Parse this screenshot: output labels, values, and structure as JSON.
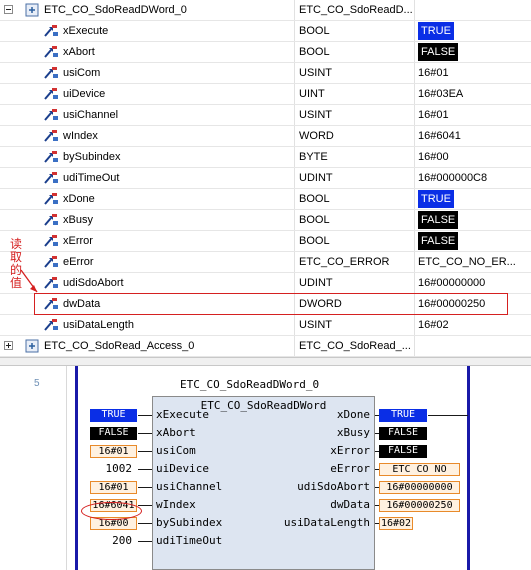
{
  "watch": {
    "parent": {
      "name": "ETC_CO_SdoReadDWord_0",
      "type": "ETC_CO_SdoReadD..."
    },
    "rows": [
      {
        "name": "xExecute",
        "type": "BOOL",
        "value": "TRUE",
        "kind": "true"
      },
      {
        "name": "xAbort",
        "type": "BOOL",
        "value": "FALSE",
        "kind": "false"
      },
      {
        "name": "usiCom",
        "type": "USINT",
        "value": "16#01",
        "kind": "text"
      },
      {
        "name": "uiDevice",
        "type": "UINT",
        "value": "16#03EA",
        "kind": "text"
      },
      {
        "name": "usiChannel",
        "type": "USINT",
        "value": "16#01",
        "kind": "text"
      },
      {
        "name": "wIndex",
        "type": "WORD",
        "value": "16#6041",
        "kind": "text"
      },
      {
        "name": "bySubindex",
        "type": "BYTE",
        "value": "16#00",
        "kind": "text"
      },
      {
        "name": "udiTimeOut",
        "type": "UDINT",
        "value": "16#000000C8",
        "kind": "text"
      },
      {
        "name": "xDone",
        "type": "BOOL",
        "value": "TRUE",
        "kind": "true"
      },
      {
        "name": "xBusy",
        "type": "BOOL",
        "value": "FALSE",
        "kind": "false"
      },
      {
        "name": "xError",
        "type": "BOOL",
        "value": "FALSE",
        "kind": "false"
      },
      {
        "name": "eError",
        "type": "ETC_CO_ERROR",
        "value": "ETC_CO_NO_ER...",
        "kind": "text"
      },
      {
        "name": "udiSdoAbort",
        "type": "UDINT",
        "value": "16#00000000",
        "kind": "text"
      },
      {
        "name": "dwData",
        "type": "DWORD",
        "value": "16#00000250",
        "kind": "text"
      },
      {
        "name": "usiDataLength",
        "type": "USINT",
        "value": "16#02",
        "kind": "text"
      }
    ],
    "footer": {
      "name": "ETC_CO_SdoRead_Access_0",
      "type": "ETC_CO_SdoRead_..."
    },
    "annotation": "读取的值"
  },
  "fbd": {
    "network_number": "5",
    "instance_name": "ETC_CO_SdoReadDWord_0",
    "block_type": "ETC_CO_SdoReadDWord",
    "inputs": [
      {
        "pin": "xExecute",
        "value": "TRUE",
        "kind": "true"
      },
      {
        "pin": "xAbort",
        "value": "FALSE",
        "kind": "false"
      },
      {
        "pin": "usiCom",
        "value": "16#01",
        "kind": "val"
      },
      {
        "pin": "uiDevice",
        "value": "1002",
        "kind": "plain"
      },
      {
        "pin": "usiChannel",
        "value": "16#01",
        "kind": "val"
      },
      {
        "pin": "wIndex",
        "value": "16#6041",
        "kind": "val"
      },
      {
        "pin": "bySubindex",
        "value": "16#00",
        "kind": "val"
      },
      {
        "pin": "udiTimeOut",
        "value": "200",
        "kind": "plain"
      }
    ],
    "outputs": [
      {
        "pin": "xDone",
        "value": "TRUE",
        "kind": "true"
      },
      {
        "pin": "xBusy",
        "value": "FALSE",
        "kind": "false"
      },
      {
        "pin": "xError",
        "value": "FALSE",
        "kind": "false"
      },
      {
        "pin": "eError",
        "value": "ETC CO NO",
        "kind": "val"
      },
      {
        "pin": "udiSdoAbort",
        "value": "16#00000000",
        "kind": "val"
      },
      {
        "pin": "dwData",
        "value": "16#00000250",
        "kind": "val"
      },
      {
        "pin": "usiDataLength",
        "value": "16#02",
        "kind": "val"
      }
    ]
  },
  "colors": {
    "true_bg": "#0a2ee6",
    "false_bg": "#000000",
    "literal_border": "#e88a2a",
    "annotation": "#d52020",
    "rail": "#1919a8"
  }
}
